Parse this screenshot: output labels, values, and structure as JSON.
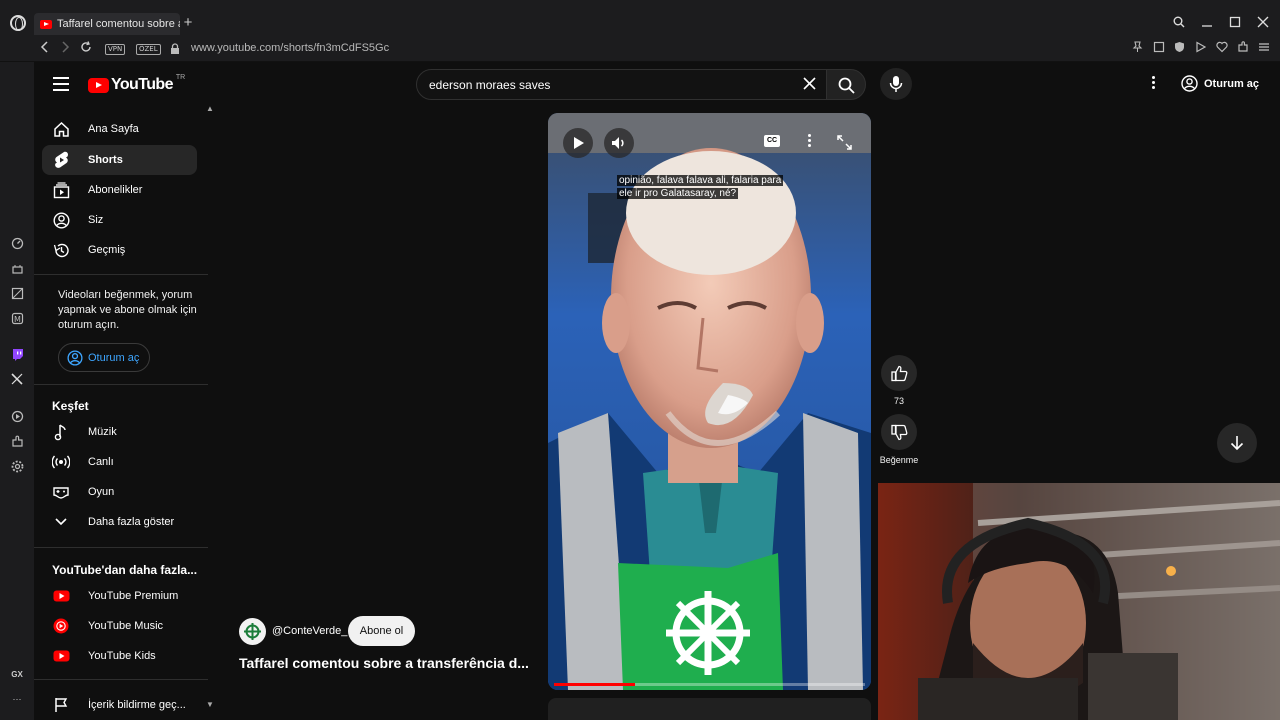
{
  "browser": {
    "tab_title": "Taffarel comentou sobre a",
    "new_tab": "+",
    "url": "www.youtube.com/shorts/fn3mCdFS5Gc",
    "vpn_badge": "VPN",
    "private_badge": "ÖZEL",
    "sidebar_gx_label": "GX",
    "sidebar_more": "···"
  },
  "header": {
    "logo_text": "YouTube",
    "country_code": "TR",
    "search_query": "ederson moraes saves",
    "signin_label": "Oturum aç"
  },
  "sidebar": {
    "main_items": [
      {
        "label": "Ana Sayfa",
        "icon": "home-icon"
      },
      {
        "label": "Shorts",
        "icon": "shorts-icon"
      },
      {
        "label": "Abonelikler",
        "icon": "subscriptions-icon"
      },
      {
        "label": "Siz",
        "icon": "you-icon"
      },
      {
        "label": "Geçmiş",
        "icon": "history-icon"
      }
    ],
    "signin_note": "Videoları beğenmek, yorum yapmak ve abone olmak için oturum açın.",
    "signin_button": "Oturum aç",
    "explore_title": "Keşfet",
    "explore_items": [
      {
        "label": "Müzik",
        "icon": "music-icon"
      },
      {
        "label": "Canlı",
        "icon": "live-icon"
      },
      {
        "label": "Oyun",
        "icon": "gaming-icon"
      },
      {
        "label": "Daha fazla göster",
        "icon": "chevron-down-icon"
      }
    ],
    "more_title": "YouTube'dan daha fazla...",
    "more_items": [
      {
        "label": "YouTube Premium",
        "icon": "youtube-premium-icon"
      },
      {
        "label": "YouTube Music",
        "icon": "youtube-music-icon"
      },
      {
        "label": "YouTube Kids",
        "icon": "youtube-kids-icon"
      }
    ],
    "report_item": "İçerik bildirme geç..."
  },
  "short": {
    "caption_line1": "opinião, falava falava ali, falaria para",
    "caption_line2": "ele ir pro Galatasaray, né?",
    "cc_label": "CC",
    "progress_fraction": 0.26,
    "channel": "@ConteVerde_",
    "subscribe_label": "Abone ol",
    "title": "Taffarel comentou sobre a transferência d...",
    "like_count": "73",
    "dislike_label": "Beğenme"
  },
  "colors": {
    "background": "#0f0f0f",
    "brand_red": "#ff0000",
    "link_blue": "#3ea6ff",
    "chrome": "#1c1c1e"
  }
}
